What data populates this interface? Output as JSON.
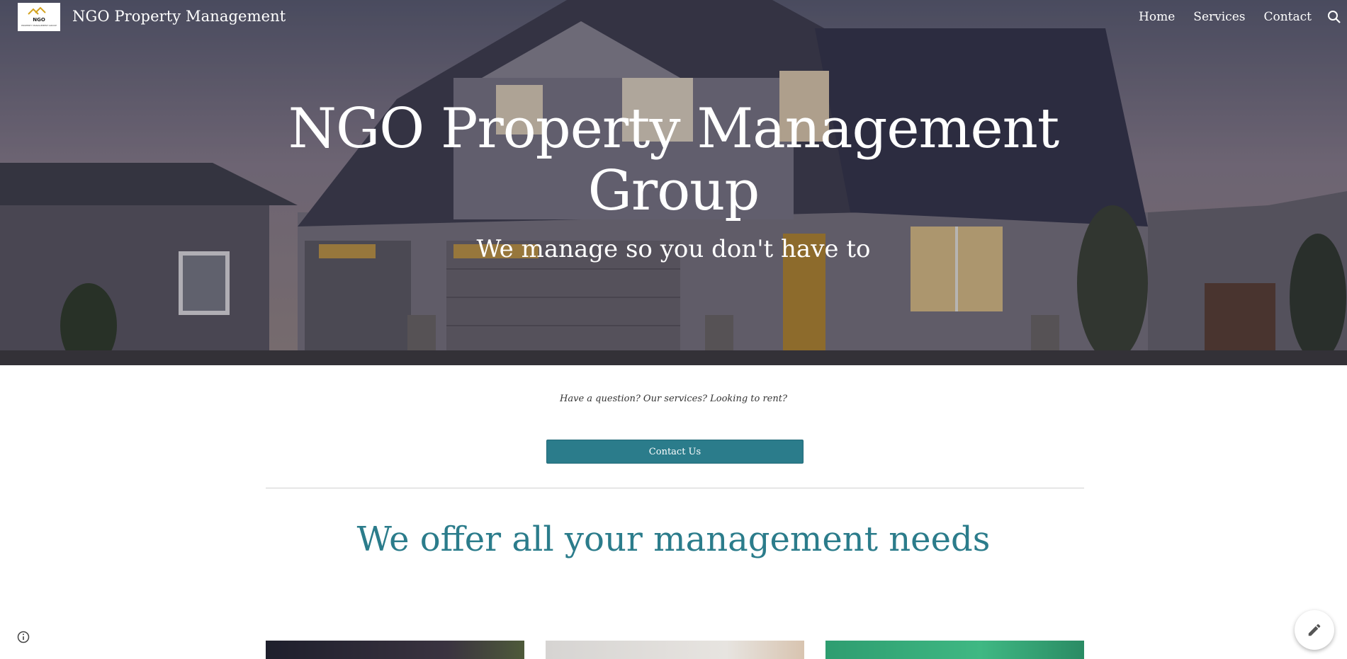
{
  "header": {
    "site_title": "NGO Property Management",
    "logo": {
      "text_main": "NGO",
      "text_sub": "PROPERTY MANAGEMENT GROUP"
    },
    "nav": [
      {
        "label": "Home"
      },
      {
        "label": "Services"
      },
      {
        "label": "Contact"
      }
    ],
    "search_icon": "search-icon"
  },
  "hero": {
    "title_line1": "NGO Property Management",
    "title_line2": "Group",
    "subtitle": "We manage so you don't have to"
  },
  "main": {
    "question_text": "Have a question? Our services? Looking to rent?",
    "contact_button_label": "Contact Us",
    "section_heading": "We offer all your management needs"
  },
  "floating": {
    "info_icon": "info-icon",
    "edit_icon": "pencil-icon"
  },
  "colors": {
    "accent": "#2b7c8b",
    "text_white": "#ffffff"
  }
}
